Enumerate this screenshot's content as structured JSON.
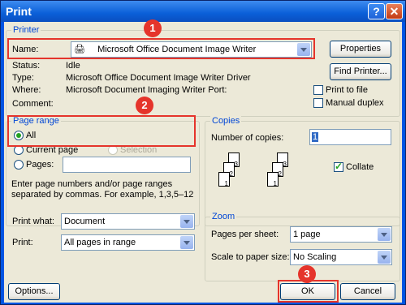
{
  "window": {
    "title": "Print"
  },
  "printer": {
    "group_label": "Printer",
    "name_label": "Name:",
    "name_value": "Microsoft Office Document Image Writer",
    "status_label": "Status:",
    "status_value": "Idle",
    "type_label": "Type:",
    "type_value": "Microsoft Office Document Image Writer Driver",
    "where_label": "Where:",
    "where_value": "Microsoft Document Imaging Writer Port:",
    "comment_label": "Comment:",
    "properties_button": "Properties",
    "find_printer_button": "Find Printer...",
    "print_to_file_label": "Print to file",
    "manual_duplex_label": "Manual duplex"
  },
  "page_range": {
    "group_label": "Page range",
    "all_label": "All",
    "current_page_label": "Current page",
    "selection_label": "Selection",
    "pages_label": "Pages:",
    "pages_value": "",
    "hint": "Enter page numbers and/or page ranges separated by commas.  For example, 1,3,5–12"
  },
  "copies": {
    "group_label": "Copies",
    "number_label": "Number of copies:",
    "number_value": "1",
    "collate_label": "Collate",
    "collate_checked": true,
    "stack_pages": [
      "1",
      "2",
      "3",
      "1",
      "2",
      "3"
    ]
  },
  "print_options": {
    "print_what_label": "Print what:",
    "print_what_value": "Document",
    "print_label": "Print:",
    "print_value": "All pages in range"
  },
  "zoom": {
    "group_label": "Zoom",
    "pages_per_sheet_label": "Pages per sheet:",
    "pages_per_sheet_value": "1 page",
    "scale_label": "Scale to paper size:",
    "scale_value": "No Scaling"
  },
  "footer": {
    "options_button": "Options...",
    "ok_button": "OK",
    "cancel_button": "Cancel"
  },
  "annotations": {
    "step1": "1",
    "step2": "2",
    "step3": "3",
    "highlight_color": "#e5342b"
  },
  "title_buttons": {
    "help_glyph": "?",
    "close_glyph": "✕"
  }
}
